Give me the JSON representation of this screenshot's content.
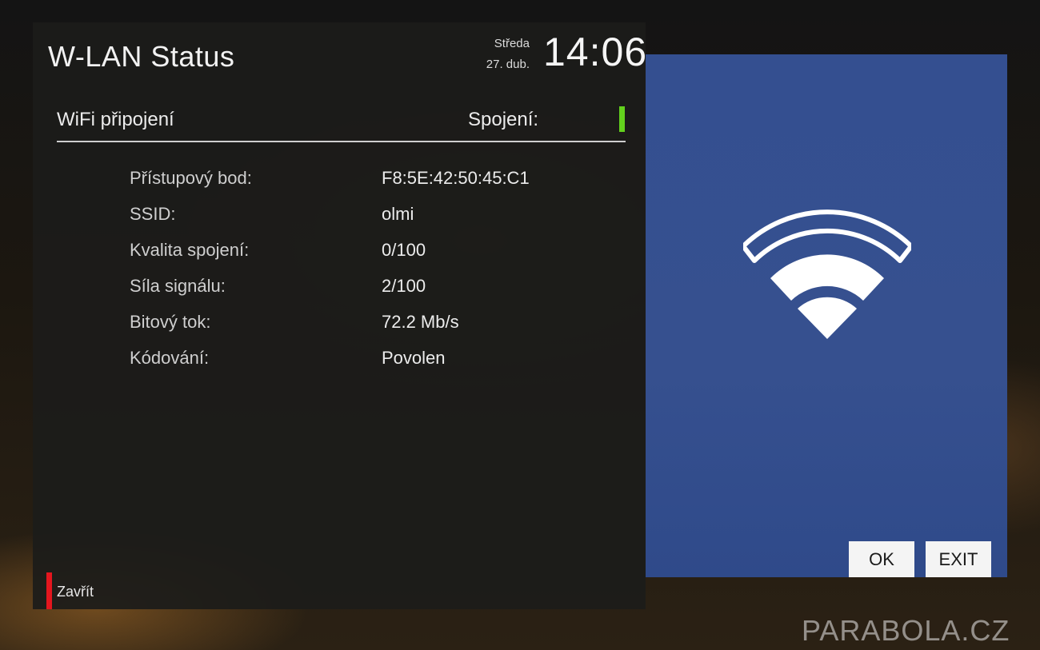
{
  "header": {
    "title": "W-LAN Status",
    "day": "Středa",
    "date": "27. dub.",
    "time": "14:06"
  },
  "connection": {
    "label": "WiFi připojení",
    "status_label": "Spojení:",
    "status_color": "#63d11d"
  },
  "info": [
    {
      "key": "Přístupový bod:",
      "value": "F8:5E:42:50:45:C1"
    },
    {
      "key": "SSID:",
      "value": "olmi"
    },
    {
      "key": "Kvalita spojení:",
      "value": "0/100"
    },
    {
      "key": "Síla signálu:",
      "value": "2/100"
    },
    {
      "key": "Bitový tok:",
      "value": "72.2 Mb/s"
    },
    {
      "key": "Kódování:",
      "value": "Povolen"
    }
  ],
  "footer": {
    "close_label": "Zavřít",
    "red_key_color": "#e4161e"
  },
  "side_panel": {
    "icon": "wifi-icon",
    "ok_label": "OK",
    "exit_label": "EXIT"
  },
  "watermark": "PARABOLA.CZ"
}
